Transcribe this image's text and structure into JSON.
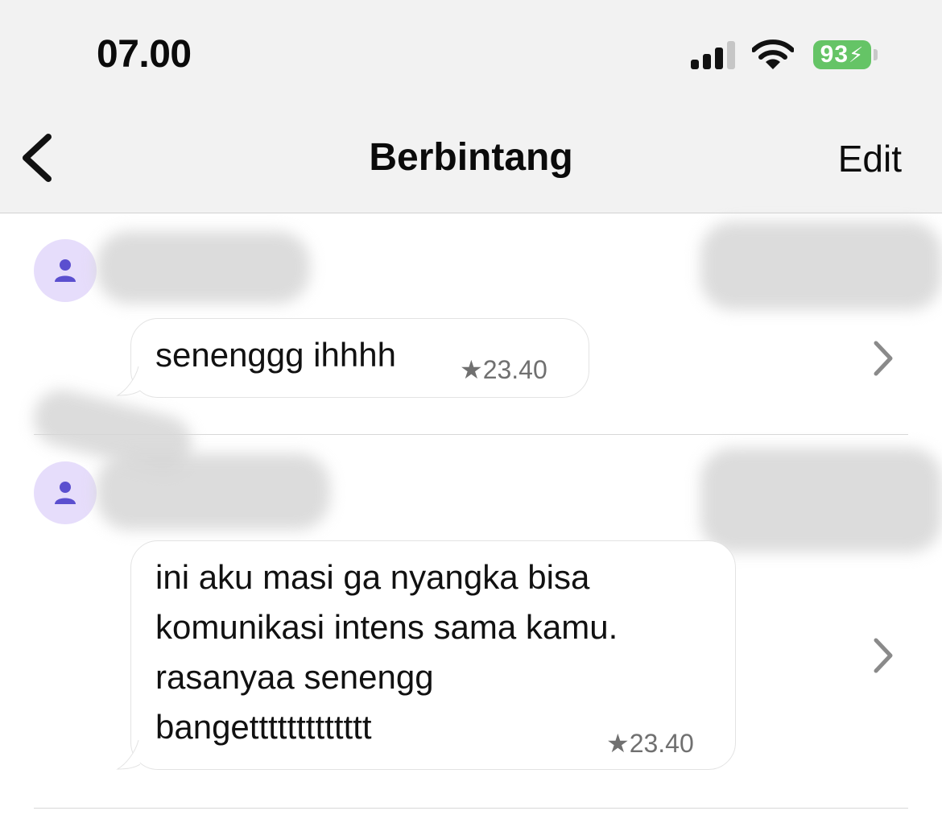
{
  "status_bar": {
    "time": "07.00",
    "battery": "93",
    "icons": [
      "signal-icon",
      "wifi-icon",
      "battery-icon"
    ]
  },
  "nav": {
    "back_icon": "chevron-left-icon",
    "title": "Berbintang",
    "edit_label": "Edit"
  },
  "messages": [
    {
      "text": "senenggg ihhhh",
      "starred_time": "★23.40"
    },
    {
      "text": "ini aku masi ga nyangka bisa\nkomunikasi intens sama kamu.\nrasanyaa senengg\nbangettttttttttttt",
      "starred_time": "★23.40"
    }
  ],
  "colors": {
    "accent": "#5b4fcf",
    "avatar_bg": "#e6ddfb",
    "battery": "#65c466",
    "header_bg": "#f2f2f2"
  }
}
